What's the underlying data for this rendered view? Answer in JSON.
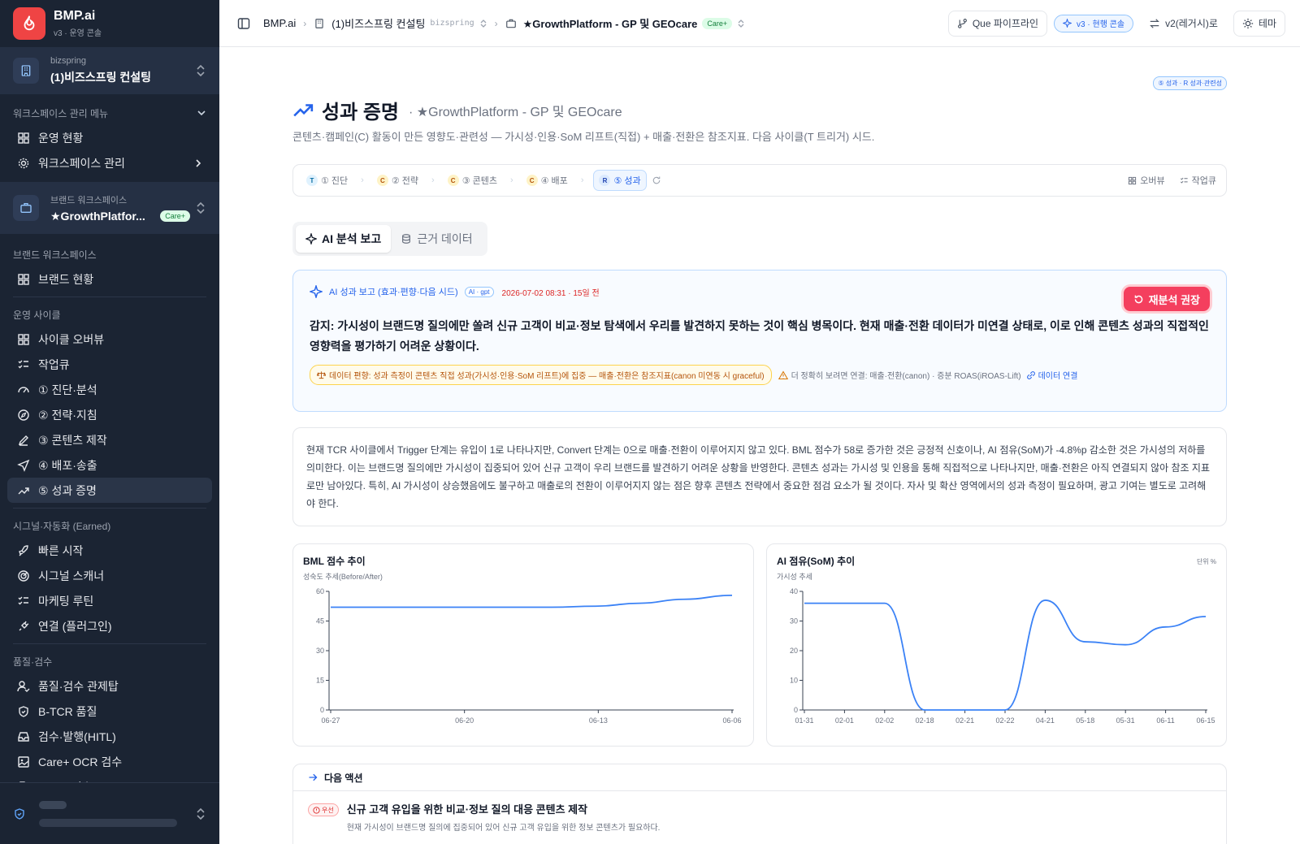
{
  "app": {
    "name": "BMP.ai",
    "version": "v3 · 운영 콘솔"
  },
  "workspace": {
    "label": "bizspring",
    "name": "(1)비즈스프링 컨설팅"
  },
  "sidebar": {
    "ws_menu_title": "워크스페이스 관리 메뉴",
    "ws_menu": [
      {
        "label": "운영 현황"
      },
      {
        "label": "워크스페이스 관리"
      }
    ],
    "brand": {
      "label": "브랜드 워크스페이스",
      "name": "★GrowthPlatfor...",
      "badge": "Care+"
    },
    "brand_section": "브랜드 워크스페이스",
    "brand_items": [
      {
        "label": "브랜드 현황"
      }
    ],
    "cycle_section": "운영 사이클",
    "cycle_items": [
      {
        "label": "사이클 오버뷰"
      },
      {
        "label": "작업큐"
      },
      {
        "label": "① 진단·분석"
      },
      {
        "label": "② 전략·지침"
      },
      {
        "label": "③ 콘텐츠 제작"
      },
      {
        "label": "④ 배포·송출"
      },
      {
        "label": "⑤ 성과 증명"
      }
    ],
    "signal_section": "시그널·자동화 (Earned)",
    "signal_items": [
      {
        "label": "빠른 시작"
      },
      {
        "label": "시그널 스캐너"
      },
      {
        "label": "마케팅 루틴"
      },
      {
        "label": "연결 (플러그인)"
      }
    ],
    "quality_section": "품질·검수",
    "quality_items": [
      {
        "label": "품질·검수 관제탑"
      },
      {
        "label": "B-TCR 품질"
      },
      {
        "label": "검수·발행(HITL)"
      },
      {
        "label": "Care+ OCR 검수"
      },
      {
        "label": "Tier-A 검수"
      }
    ]
  },
  "topbar": {
    "crumbs": [
      "BMP.ai",
      "(1)비즈스프링 컨설팅",
      "★GrowthPlatform - GP 및 GEOcare"
    ],
    "crumb_mono": "bizspring",
    "crumb_badge": "Care+",
    "pipeline": "Que 파이프라인",
    "console": "v3 · 현행 콘솔",
    "legacy": "v2(레거시)로",
    "theme": "테마"
  },
  "page": {
    "tag": "⑤ 성과 · R 성과·관련성",
    "title": "성과 증명",
    "subtitle": "· ★GrowthPlatform - GP 및 GEOcare",
    "desc": "콘텐츠·캠페인(C) 활동이 만든 영향도·관련성 — 가시성·인용·SoM 리프트(직접) + 매출·전환은 참조지표. 다음 사이클(T 트리거) 시드."
  },
  "stepper": {
    "steps": [
      {
        "letter": "T",
        "label": "① 진단"
      },
      {
        "letter": "C",
        "label": "② 전략"
      },
      {
        "letter": "C",
        "label": "③ 콘텐츠"
      },
      {
        "letter": "C",
        "label": "④ 배포"
      },
      {
        "letter": "R",
        "label": "⑤ 성과"
      }
    ],
    "overview": "오버뷰",
    "queue": "작업큐"
  },
  "tabs": {
    "ai": "AI 분석 보고",
    "data": "근거 데이터"
  },
  "report": {
    "title": "AI 성과 보고 (효과·편향·다음 시드)",
    "model": "AI · gpt",
    "time": "2026-07-02 08:31 · 15일 전",
    "reanalyze": "재분석 권장",
    "text": "감지: 가시성이 브랜드명 질의에만 쏠려 신규 고객이 비교·정보 탐색에서 우리를 발견하지 못하는 것이 핵심 병목이다. 현재 매출·전환 데이터가 미연결 상태로, 이로 인해 콘텐츠 성과의 직접적인 영향력을 평가하기 어려운 상황이다.",
    "bias": "데이터 편향: 성과 측정이 콘텐츠 직접 성과(가시성·인용·SoM 리프트)에 집중 — 매출·전환은 참조지표(canon 미연동 시 graceful)",
    "warn": "더 정확히 보려면 연결: 매출·전환(canon) · 증분 ROAS(iROAS-Lift)",
    "link": "데이터 연결"
  },
  "summary": "현재 TCR 사이클에서 Trigger 단계는 유입이 1로 나타나지만, Convert 단계는 0으로 매출·전환이 이루어지지 않고 있다. BML 점수가 58로 증가한 것은 긍정적 신호이나, AI 점유(SoM)가 -4.8%p 감소한 것은 가시성의 저하를 의미한다. 이는 브랜드명 질의에만 가시성이 집중되어 있어 신규 고객이 우리 브랜드를 발견하기 어려운 상황을 반영한다. 콘텐츠 성과는 가시성 및 인용을 통해 직접적으로 나타나지만, 매출·전환은 아직 연결되지 않아 참조 지표로만 남아있다. 특히, AI 가시성이 상승했음에도 불구하고 매출로의 전환이 이루어지지 않는 점은 향후 콘텐츠 전략에서 중요한 점검 요소가 될 것이다. 자사 및 확산 영역에서의 성과 측정이 필요하며, 광고 기여는 별도로 고려해야 한다.",
  "charts": {
    "bml": {
      "title": "BML 점수 추이",
      "subtitle": "성숙도 추세(Before/After)"
    },
    "som": {
      "title": "AI 점유(SoM) 추이",
      "subtitle": "가시성 추세",
      "unit": "단위 %"
    }
  },
  "chart_data": [
    {
      "type": "line",
      "title": "BML 점수 추이",
      "subtitle": "성숙도 추세(Before/After)",
      "x": [
        "06-27",
        "06-20",
        "06-13",
        "06-06"
      ],
      "series": [
        {
          "values": [
            52,
            52,
            52,
            52,
            52,
            52,
            52.5,
            54,
            56,
            58
          ],
          "x_pos": [
            0,
            0.11,
            0.22,
            0.33,
            0.44,
            0.55,
            0.66,
            0.77,
            0.88,
            1.0
          ]
        }
      ],
      "ylim": [
        0,
        60
      ],
      "yticks": [
        0,
        15,
        30,
        45,
        60
      ],
      "color": "#3b82f6"
    },
    {
      "type": "line",
      "title": "AI 점유(SoM) 추이",
      "subtitle": "가시성 추세",
      "x": [
        "01-31",
        "02-01",
        "02-02",
        "02-18",
        "02-21",
        "02-22",
        "04-21",
        "05-18",
        "05-31",
        "06-11",
        "06-15"
      ],
      "series": [
        {
          "values": [
            36,
            36,
            36,
            0,
            0,
            0,
            37,
            23,
            22,
            28,
            31.5
          ]
        }
      ],
      "ylim": [
        0,
        40
      ],
      "yticks": [
        0,
        10,
        20,
        30,
        40
      ],
      "color": "#3b82f6"
    }
  ],
  "next": {
    "title": "다음 액션",
    "priority": "우선",
    "item_title": "신규 고객 유입을 위한 비교·정보 질의 대응 콘텐츠 제작",
    "item_desc": "현재 가시성이 브랜드명 질의에 집중되어 있어 신규 고객 유입을 위한 정보 콘텐츠가 필요하다."
  }
}
